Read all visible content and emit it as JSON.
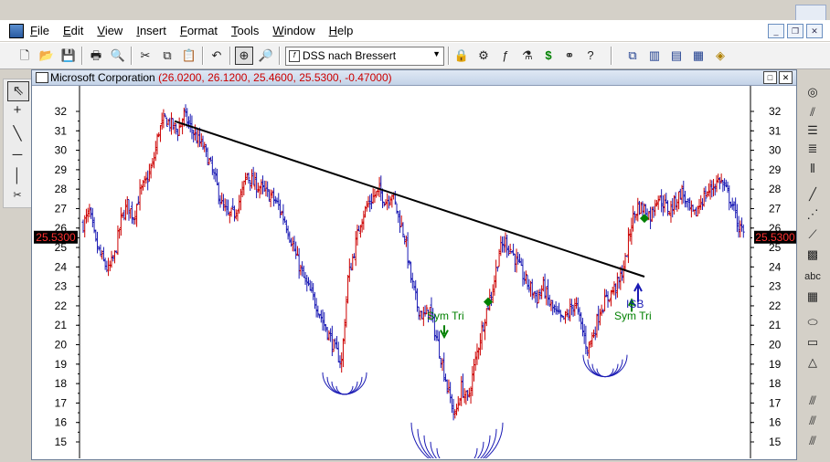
{
  "menu": {
    "items": [
      "File",
      "Edit",
      "View",
      "Insert",
      "Format",
      "Tools",
      "Window",
      "Help"
    ]
  },
  "toolbar": {
    "study_dropdown": "DSS nach Bressert"
  },
  "chart_window": {
    "title": "Microsoft Corporation",
    "quote": "(26.0200, 26.1200, 25.4600, 25.5300, -0.47000)"
  },
  "right_tools": {
    "text_label": "abc"
  },
  "chart_data": {
    "type": "ohlc",
    "title": "Microsoft Corporation",
    "y_ticks": [
      32,
      31,
      30,
      29,
      28,
      27,
      26,
      25,
      24,
      23,
      22,
      21,
      20,
      19,
      18,
      17,
      16,
      15
    ],
    "ylim": [
      14.5,
      32.6
    ],
    "last_price": "25.5300",
    "closes": [
      26.2,
      26.8,
      25.2,
      24.4,
      23.8,
      24.6,
      26.4,
      27.2,
      26.6,
      27.8,
      28.4,
      29.2,
      31.0,
      31.6,
      31.3,
      31.0,
      31.8,
      31.2,
      30.6,
      30.2,
      29.4,
      28.4,
      27.2,
      26.6,
      26.8,
      27.6,
      28.8,
      28.3,
      28.1,
      27.8,
      27.6,
      27.1,
      26.4,
      25.4,
      24.3,
      23.4,
      22.7,
      22.1,
      21.2,
      20.5,
      19.7,
      19.1,
      23.4,
      24.8,
      26.4,
      27.1,
      27.6,
      27.9,
      27.4,
      27.8,
      26.6,
      25.6,
      23.4,
      22.0,
      21.4,
      21.8,
      20.4,
      19.0,
      17.5,
      16.3,
      17.8,
      17.1,
      18.8,
      20.4,
      21.8,
      22.9,
      24.8,
      25.3,
      24.8,
      24.1,
      23.4,
      22.9,
      22.4,
      23.0,
      22.1,
      21.6,
      21.2,
      21.6,
      22.2,
      21.0,
      19.8,
      20.6,
      21.8,
      22.3,
      22.8,
      23.2,
      24.3,
      26.3,
      27.1,
      27.0,
      26.6,
      27.6,
      27.3,
      26.9,
      27.4,
      27.9,
      27.0,
      26.6,
      27.4,
      27.8,
      28.2,
      28.5,
      27.9,
      27.2,
      26.1,
      25.5
    ],
    "trendline": {
      "from": 31.5,
      "to": 23.5
    },
    "annotations": [
      "Sym Tri",
      "Sym Tri",
      "ISB"
    ],
    "colors": {
      "up": "#cc0000",
      "down": "#1a1ab4",
      "signal": "#008000"
    }
  }
}
